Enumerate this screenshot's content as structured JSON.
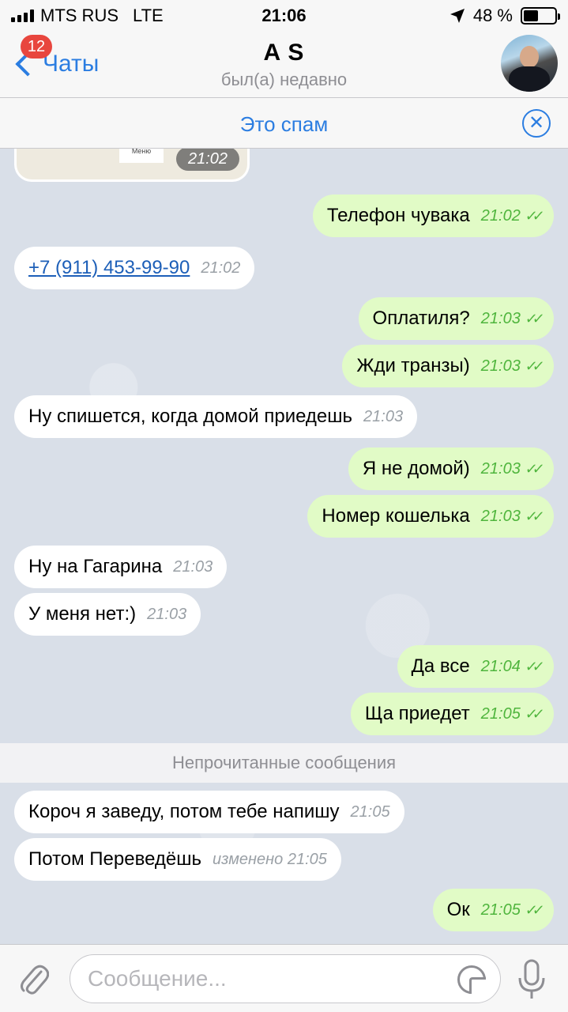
{
  "status": {
    "carrier": "MTS RUS",
    "network": "LTE",
    "time": "21:06",
    "battery_percent": "48 %",
    "battery_level": 0.48
  },
  "header": {
    "back_label": "Чаты",
    "unread_badge": "12",
    "contact_name": "A S",
    "last_seen": "был(а) недавно"
  },
  "spam_bar": {
    "label": "Это спам"
  },
  "map_preview": {
    "menu_label": "Меню",
    "time": "21:02"
  },
  "messages": [
    {
      "dir": "out",
      "text": "Телефон чувака",
      "time": "21:02"
    },
    {
      "dir": "in",
      "text": "+7 (911) 453-99-90",
      "time": "21:02",
      "link": true
    },
    {
      "dir": "out",
      "text": "Оплатиля?",
      "time": "21:03"
    },
    {
      "dir": "out",
      "text": "Жди транзы)",
      "time": "21:03"
    },
    {
      "dir": "in",
      "text": "Ну спишется,  когда домой приедешь",
      "time": "21:03"
    },
    {
      "dir": "out",
      "text": "Я не домой)",
      "time": "21:03"
    },
    {
      "dir": "out",
      "text": "Номер кошелька",
      "time": "21:03"
    },
    {
      "dir": "in",
      "text": "Ну на Гагарина",
      "time": "21:03"
    },
    {
      "dir": "in",
      "text": "У меня нет:)",
      "time": "21:03"
    },
    {
      "dir": "out",
      "text": "Да все",
      "time": "21:04"
    },
    {
      "dir": "out",
      "text": "Ща приедет",
      "time": "21:05"
    },
    {
      "dir": "in",
      "text": "Короч я заведу, потом тебе напишу",
      "time": "21:05"
    },
    {
      "dir": "in",
      "text": "Потом Переведёшь",
      "time": "изменено 21:05"
    },
    {
      "dir": "out",
      "text": "Ок",
      "time": "21:05"
    }
  ],
  "unread_divider": "Непрочитанные сообщения",
  "composer": {
    "placeholder": "Сообщение..."
  },
  "colors": {
    "accent": "#2b7de1",
    "outgoing_bubble": "#e1fbc6",
    "badge": "#e8463e",
    "read_ticks": "#4fb53d"
  }
}
